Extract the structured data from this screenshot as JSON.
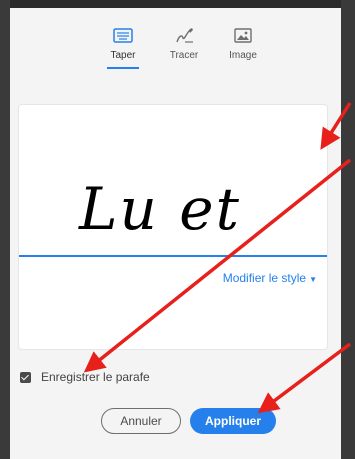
{
  "tabs": [
    {
      "label": "Taper",
      "icon": "keyboard-icon",
      "active": true
    },
    {
      "label": "Tracer",
      "icon": "pen-draw-icon",
      "active": false
    },
    {
      "label": "Image",
      "icon": "image-icon",
      "active": false
    }
  ],
  "signature": {
    "text": "Lu et",
    "change_style_label": "Modifier le style",
    "accent_color": "#2680eb"
  },
  "save_initials": {
    "label": "Enregistrer le parafe",
    "checked": true
  },
  "buttons": {
    "cancel": "Annuler",
    "apply": "Appliquer"
  },
  "annotation_color": "#e8201b"
}
